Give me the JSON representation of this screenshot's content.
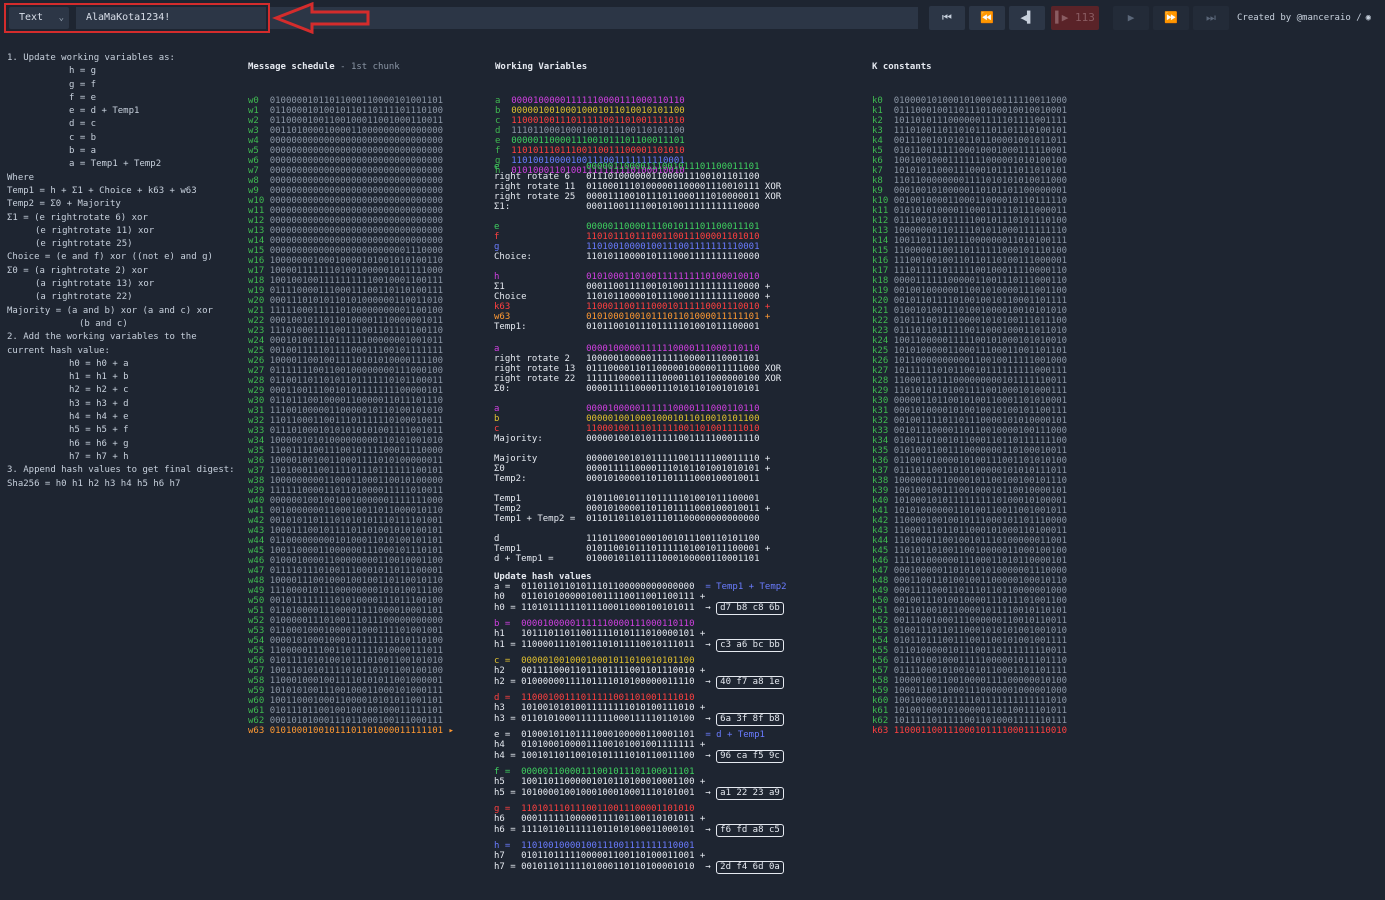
{
  "toolbar": {
    "input_type": "Text",
    "input_value": "AlaMaKota1234!",
    "step": "113",
    "credits": "Created by @manceraio /"
  },
  "left": {
    "s1_title": "1. Update working variables as:",
    "assign": [
      "h = g",
      "g = f",
      "f = e",
      "e = d + Temp1",
      "d = c",
      "c = b",
      "b = a",
      "a = Temp1 + Temp2"
    ],
    "where": "Where",
    "temp1": "Temp1 = h + Σ1 + Choice + k63 + w63",
    "temp2": "Temp2 = Σ0 + Majority",
    "sigma1": [
      "Σ1 = (e rightrotate 6) xor",
      "(e rightrotate 11) xor",
      "(e rightrotate 25)"
    ],
    "choice": "Choice = (e and f) xor ((not e) and g)",
    "sigma0": [
      "Σ0 = (a rightrotate 2) xor",
      "(a rightrotate 13) xor",
      "(a rightrotate 22)"
    ],
    "majority": [
      "Majority = (a and b) xor (a and c) xor",
      "(b and c)"
    ],
    "s2_title": [
      "2. Add the working variables to the",
      "current hash value:"
    ],
    "hash_add": [
      "h0 = h0 + a",
      "h1 = h1 + b",
      "h2 = h2 + c",
      "h3 = h3 + d",
      "h4 = h4 + e",
      "h5 = h5 + f",
      "h6 = h6 + g",
      "h7 = h7 + h"
    ],
    "s3_title": "3. Append hash values to get final digest:",
    "sha": "Sha256 = h0 h1 h2 h3 h4 h5 h6 h7"
  },
  "schedule": {
    "title": "Message schedule",
    "subtitle": "- 1st chunk",
    "rows": [
      "01000001011011000110000101001101",
      "01100001010010110110111101110100",
      "01100001001100100011001000110011",
      "00110100001000011000000000000000",
      "00000000000000000000000000000000",
      "00000000000000000000000000000000",
      "00000000000000000000000000000000",
      "00000000000000000000000000000000",
      "00000000000000000000000000000000",
      "00000000000000000000000000000000",
      "00000000000000000000000000000000",
      "00000000000000000000000000000000",
      "00000000000000000000000000000000",
      "00000000000000000000000000000000",
      "00000000000000000000000000000000",
      "00000000000000000000000001110000",
      "10000000100010000101001010100110",
      "10000111111101001000001011111000",
      "10010010011111111110010001100111",
      "01111000011100011100110110100111",
      "00011101010110101000000110011010",
      "11111000111110100000000001100100",
      "00010010110110100001110000001011",
      "11101000111100111001101111100110",
      "00010100111011111100000001001011",
      "00100111110111100011100101111111",
      "10000110010011110101010000111100",
      "01111111001100100000000111000100",
      "01100110110101101111110101100011",
      "00011001110010101111111100000101",
      "01101110010000110000011011101110",
      "11100100000110000010110100101010",
      "11011000110011101111110100010011",
      "01110100010101010101001111001011",
      "10000010101000000000110101001010",
      "11001111001110010111100011110000",
      "10000100100110001111010100000011",
      "11010001100111101110111111100101",
      "10000000001100011000110010100000",
      "11111100001101101000011111010011",
      "00000010010010010000001111111000",
      "00100000001100010011011000010110",
      "00101011011101010101110111101001",
      "10001110010111101101001010100101",
      "01100000000010100011010100101101",
      "10011000011000000111000101110101",
      "01000100001100000000110010001100",
      "01111011101001110001011011100001",
      "10000111001000100100110110010110",
      "11100001011100000000101010011100",
      "00101111111101010000111011100100",
      "01101000011100001111000010001101",
      "01000001110100111011100000000000",
      "01100010001000011000111101001001",
      "00001010001000101111111010110100",
      "11000001110011011111010000111011",
      "01011110101001011101001100101010",
      "10011010101111010110101100100100",
      "11000100010011110101011001000001",
      "10101010011100100011000101000111",
      "10011000100011000010101011001101",
      "01011101100100100100100011111101",
      "00010101000111011000100111000111",
      "01010001001011101101000011111101"
    ]
  },
  "working": {
    "title": "Working Variables",
    "rows": [
      {
        "k": "a",
        "v": "00001000001111110000111000110110",
        "c": "cm"
      },
      {
        "k": "b",
        "v": "00000100100010001011010010101100",
        "c": "cy"
      },
      {
        "k": "c",
        "v": "11000100111011111001101001111010",
        "c": "cr"
      },
      {
        "k": "d",
        "v": "11101100010001001011100110101100",
        "c": "cgr"
      },
      {
        "k": "e",
        "v": "00000110000111001011101100011101",
        "c": "cg"
      },
      {
        "k": "f",
        "v": "11010111011100110011100001101010",
        "c": "cr"
      },
      {
        "k": "g",
        "v": "11010010000100111001111111110001",
        "c": "cb"
      },
      {
        "k": "h",
        "v": "01010001101001111111110100010010",
        "c": "cm"
      }
    ]
  },
  "calc": {
    "e_block": [
      {
        "k": "e",
        "v": "00000110000111001011101100011101",
        "kc": "cg",
        "vc": "cg"
      },
      {
        "k": "right rotate 6",
        "v": "01110100000011000011100101101100",
        "kc": "cw",
        "vc": "cw"
      },
      {
        "k": "right rotate 11",
        "v": "01100011101000001100001110010111 XOR",
        "kc": "cw",
        "vc": "cw"
      },
      {
        "k": "right rotate 25",
        "v": "00001110010111011000111010000011 XOR",
        "kc": "cw",
        "vc": "cw"
      },
      {
        "k": "Σ1:",
        "v": "00011001111001010011111111110000",
        "kc": "cw",
        "vc": "cw"
      }
    ],
    "choice_block": [
      {
        "k": "e",
        "v": "00000110000111001011101100011101",
        "kc": "cg",
        "vc": "cg"
      },
      {
        "k": "f",
        "v": "11010111011100110011100001101010",
        "kc": "cr",
        "vc": "cr"
      },
      {
        "k": "g",
        "v": "11010010000100111001111111110001",
        "kc": "cb",
        "vc": "cb"
      },
      {
        "k": "Choice:",
        "v": "11010110000101110001111111110000",
        "kc": "cw",
        "vc": "cw"
      }
    ],
    "temp1_block": [
      {
        "k": "h",
        "v": "01010001101001111111110100010010",
        "kc": "cm",
        "vc": "cm"
      },
      {
        "k": "Σ1",
        "v": "00011001111001010011111111110000 +",
        "kc": "cw",
        "vc": "cw"
      },
      {
        "k": "Choice",
        "v": "11010110000101110001111111110000 +",
        "kc": "cw",
        "vc": "cw"
      },
      {
        "k": "k63",
        "v": "11000110011100010111110001110010 +",
        "kc": "cr",
        "vc": "cr"
      },
      {
        "k": "w63",
        "v": "01010001001011101101000011111101 +",
        "kc": "co",
        "vc": "co"
      },
      {
        "k": "Temp1:",
        "v": "01011001011101111101001011100001",
        "kc": "cw",
        "vc": "cw"
      }
    ],
    "a_block": [
      {
        "k": "a",
        "v": "00001000001111110000111000110110",
        "kc": "cm",
        "vc": "cm"
      },
      {
        "k": "right rotate 2",
        "v": "10000010000011111100001110001101",
        "kc": "cw",
        "vc": "cw"
      },
      {
        "k": "right rotate 13",
        "v": "01110000110110000010000011111000 XOR",
        "kc": "cw",
        "vc": "cw"
      },
      {
        "k": "right rotate 22",
        "v": "11111100001111000011011000000100 XOR",
        "kc": "cw",
        "vc": "cw"
      },
      {
        "k": "Σ0:",
        "v": "00001111100001110101101001010101",
        "kc": "cw",
        "vc": "cw"
      }
    ],
    "maj_block": [
      {
        "k": "a",
        "v": "00001000001111110000111000110110",
        "kc": "cm",
        "vc": "cm"
      },
      {
        "k": "b",
        "v": "00000100100010001011010010101100",
        "kc": "cy",
        "vc": "cy"
      },
      {
        "k": "c",
        "v": "11000100111011111001101001111010",
        "kc": "cr",
        "vc": "cr"
      },
      {
        "k": "Majority:",
        "v": "00000100101011111001111100011110",
        "kc": "cw",
        "vc": "cw"
      }
    ],
    "temp2_block": [
      {
        "k": "Majority",
        "v": "00000100101011111001111100011110 +",
        "kc": "cw",
        "vc": "cw"
      },
      {
        "k": "Σ0",
        "v": "00001111100001110101101001010101 +",
        "kc": "cw",
        "vc": "cw"
      },
      {
        "k": "Temp2:",
        "v": "00010100001101101111000100010011",
        "kc": "cw",
        "vc": "cw"
      }
    ],
    "a_new": [
      {
        "k": "Temp1",
        "v": "01011001011101111101001011100001",
        "kc": "cw",
        "vc": "cw"
      },
      {
        "k": "Temp2",
        "v": "00010100001101101111000100010011 +",
        "kc": "cw",
        "vc": "cw"
      },
      {
        "k": "Temp1 + Temp2 =",
        "v": "01101101101011101100000000000000",
        "kc": "cw",
        "vc": "cw"
      }
    ],
    "e_new": [
      {
        "k": "d",
        "v": "11101100010001001011100110101100",
        "kc": "cw",
        "vc": "cw"
      },
      {
        "k": "Temp1",
        "v": "01011001011101111101001011100001 +",
        "kc": "cw",
        "vc": "cw"
      },
      {
        "k": "d + Temp1 =",
        "v": "01000101101111000100000110001101",
        "kc": "cw",
        "vc": "cw"
      }
    ],
    "update_title": "Update hash values",
    "update": [
      {
        "r": [
          [
            "a =",
            "01101101101011101100000000000000",
            "= Temp1 + Temp2",
            "cw"
          ],
          [
            "h0",
            "01101010000010011110011001100111 +",
            "",
            "cw"
          ],
          [
            "h0 =",
            "11010111111011100011000100101011",
            "d7 b8 c8 6b",
            "cw"
          ]
        ]
      },
      {
        "r": [
          [
            "b =",
            "00001000001111110000111000110110",
            "",
            "cm"
          ],
          [
            "h1",
            "10111011011001111010111010000101 +",
            "",
            "cw"
          ],
          [
            "h1 =",
            "11000011101001101011110010111011",
            "c3 a6 bc bb",
            "cw"
          ]
        ]
      },
      {
        "r": [
          [
            "c =",
            "00000100100010001011010010101100",
            "",
            "cy"
          ],
          [
            "h2",
            "00111100011011101111001101110010 +",
            "",
            "cw"
          ],
          [
            "h2 =",
            "01000000111101111010100000011110",
            "40 f7 a8 1e",
            "cw"
          ]
        ]
      },
      {
        "r": [
          [
            "d =",
            "11000100111011111001101001111010",
            "",
            "cr"
          ],
          [
            "h3",
            "10100101010011111111010100111010 +",
            "",
            "cw"
          ],
          [
            "h3 =",
            "01101010001111111000111110110100",
            "6a 3f 8f b8",
            "cw"
          ]
        ]
      },
      {
        "r": [
          [
            "e =",
            "01000101101111000100000110001101",
            "= d + Temp1",
            "cw"
          ],
          [
            "h4",
            "01010001000011100101001001111111 +",
            "",
            "cw"
          ],
          [
            "h4 =",
            "10010110110010101111010110011100",
            "96 ca f5 9c",
            "cw"
          ]
        ]
      },
      {
        "r": [
          [
            "f =",
            "00000110000111001011101100011101",
            "",
            "cg"
          ],
          [
            "h5",
            "10011011000001010110100010001100 +",
            "",
            "cw"
          ],
          [
            "h5 =",
            "10100001001000100010001110101001",
            "a1 22 23 a9",
            "cw"
          ]
        ]
      },
      {
        "r": [
          [
            "g =",
            "11010111011100110011100001101010",
            "",
            "cr"
          ],
          [
            "h6",
            "00011111100000111101100110101011 +",
            "",
            "cw"
          ],
          [
            "h6 =",
            "11110110111111011010100011000101",
            "f6 fd a8 c5",
            "cw"
          ]
        ]
      },
      {
        "r": [
          [
            "h =",
            "11010010000100111001111111110001",
            "",
            "cb"
          ],
          [
            "h7",
            "01011011111000001100110100011001 +",
            "",
            "cw"
          ],
          [
            "h7 =",
            "00101101111101000110110100001010",
            "2d f4 6d 0a",
            "cw"
          ]
        ]
      }
    ]
  },
  "kconst": {
    "title": "K constants",
    "rows": [
      "01000010100010100010111110011000",
      "01110001001101110100010010010001",
      "10110101110000001111101111001111",
      "11101001101101011101101110100101",
      "00111001010101101100001001011011",
      "01011001111100010001000111110001",
      "10010010001111111000001010100100",
      "10101011000111000101111011010101",
      "11011000000001111010101010011000",
      "00010010100000110101101100000001",
      "00100100001100011000010110111110",
      "01010101000011000111110111000011",
      "01110010101111100101110101110100",
      "10000000110111101011000111111110",
      "10011011110111000000011010100111",
      "11000001100110111111000101110100",
      "11100100100110110110100111000001",
      "11101111101111100100011110000110",
      "00001111110000011001110111000110",
      "00100100000011001010000111001100",
      "00101101111010010010110001101111",
      "01001010011101001000010010101010",
      "01011100101100001010100111011100",
      "01110110111110011000100011011010",
      "10011000001111100101000101010010",
      "10101000001100011100011001101101",
      "10110000000000110010011111001000",
      "10111111010110010111111111000111",
      "11000110111000000000101111110011",
      "11010101101001111001000101000111",
      "00000110110010100110001101010001",
      "00010100001010010010100101100111",
      "00100111101101110000101010000101",
      "00101110000110110010000100111000",
      "01001101001011000110110111111100",
      "01010011001110000000110100010011",
      "01100101000010100111001101010100",
      "01110110011010100000101010111011",
      "10000001110000101100100100101110",
      "10010010011100100010110010000101",
      "10100010101111111110100010100001",
      "10101000000110100110011001001011",
      "11000010010010111000101101110000",
      "11000111011011000101000110100011",
      "11010001100100101110100000011001",
      "11010110100110010000011000100100",
      "11110100000011100011010110000101",
      "00010000011010101010000001110000",
      "00011001101001001100000100010110",
      "00011110001101110110110000001000",
      "00100111010010000111011101001100",
      "00110100101100001011110010110101",
      "00111001000111000000110010110011",
      "01001110110110001010101001001010",
      "01011011100111001100101001001111",
      "01101000001011100110111111110011",
      "01110100100011111000001011101110",
      "01111000101001010110001101101111",
      "10000100110010000111100000010100",
      "10001100110001110000001000001000",
      "10010000101111101111111111111010",
      "10100100010100000110110011101011",
      "10111110111110011010001111110111",
      "11000110011100010111100011110010"
    ]
  }
}
